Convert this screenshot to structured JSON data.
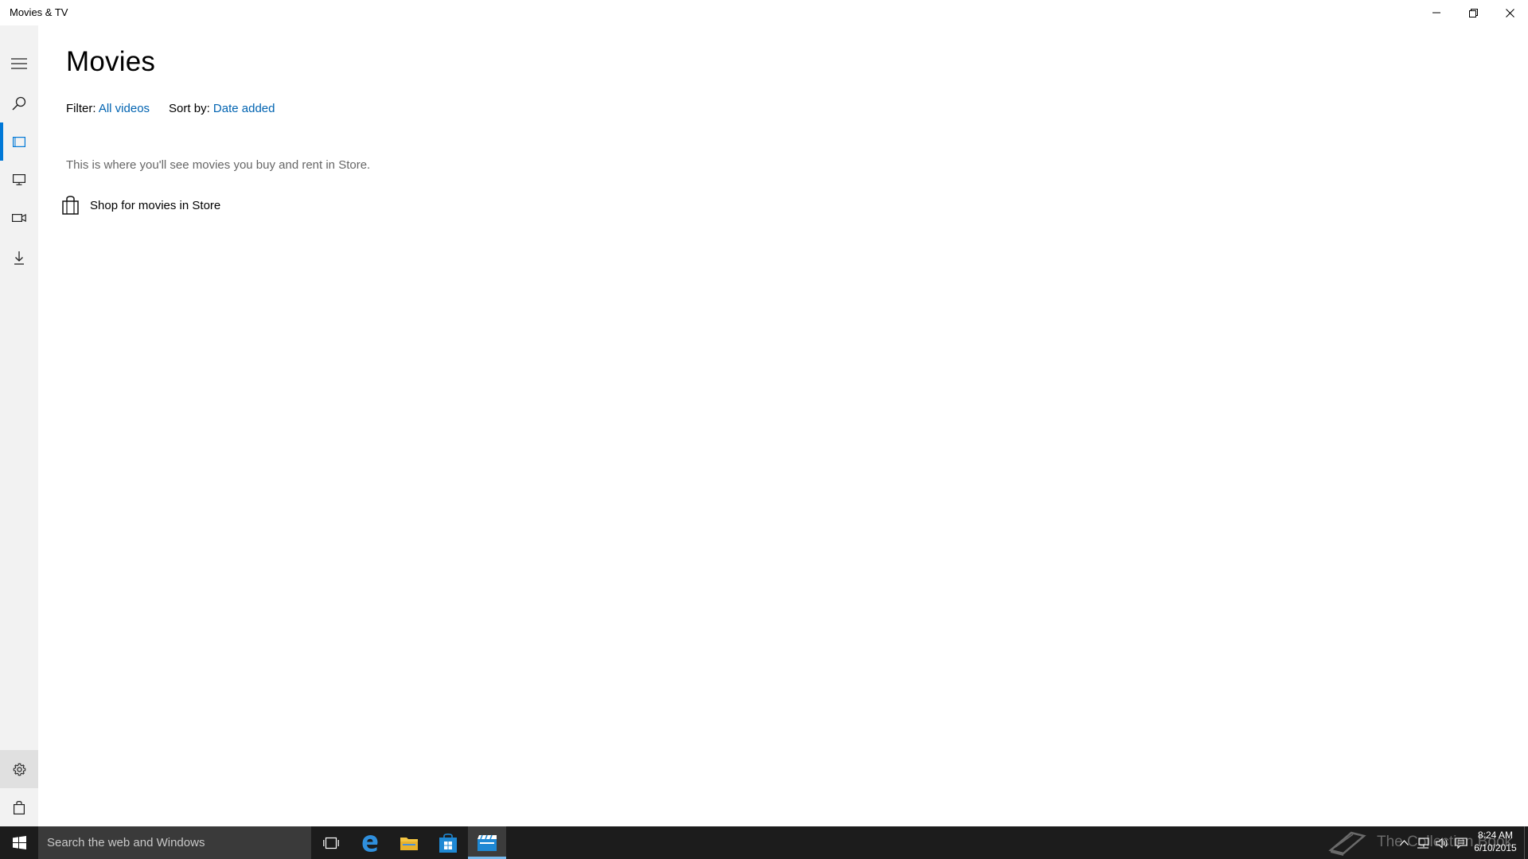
{
  "window": {
    "title": "Movies & TV"
  },
  "nav": {
    "items": [
      {
        "name": "menu",
        "icon": "hamburger-icon"
      },
      {
        "name": "search",
        "icon": "search-icon"
      },
      {
        "name": "movies",
        "icon": "film-icon",
        "selected": true
      },
      {
        "name": "tv",
        "icon": "tv-icon"
      },
      {
        "name": "videos",
        "icon": "video-camera-icon"
      },
      {
        "name": "downloads",
        "icon": "download-icon"
      },
      {
        "name": "settings",
        "icon": "gear-icon"
      },
      {
        "name": "store",
        "icon": "shopping-bag-icon"
      }
    ]
  },
  "main": {
    "title": "Movies",
    "filter_label": "Filter:",
    "filter_value": "All videos",
    "sort_label": "Sort by:",
    "sort_value": "Date added",
    "empty_message": "This is where you'll see movies you buy and rent in Store.",
    "shop_link": "Shop for movies in Store"
  },
  "taskbar": {
    "search_placeholder": "Search the web and Windows",
    "pinned": [
      {
        "name": "task-view",
        "icon": "task-view-icon"
      },
      {
        "name": "edge",
        "icon": "edge-icon"
      },
      {
        "name": "file-explorer",
        "icon": "folder-icon"
      },
      {
        "name": "store",
        "icon": "store-icon"
      },
      {
        "name": "movies-tv",
        "icon": "movies-tv-icon",
        "active": true
      }
    ],
    "watermark": "The Collection Book",
    "time": "8:24 AM",
    "date": "6/10/2015"
  },
  "colors": {
    "accent": "#0078d7",
    "link": "#0063b1",
    "rail_bg": "#f2f2f2",
    "taskbar_bg": "#1c1c1c"
  }
}
